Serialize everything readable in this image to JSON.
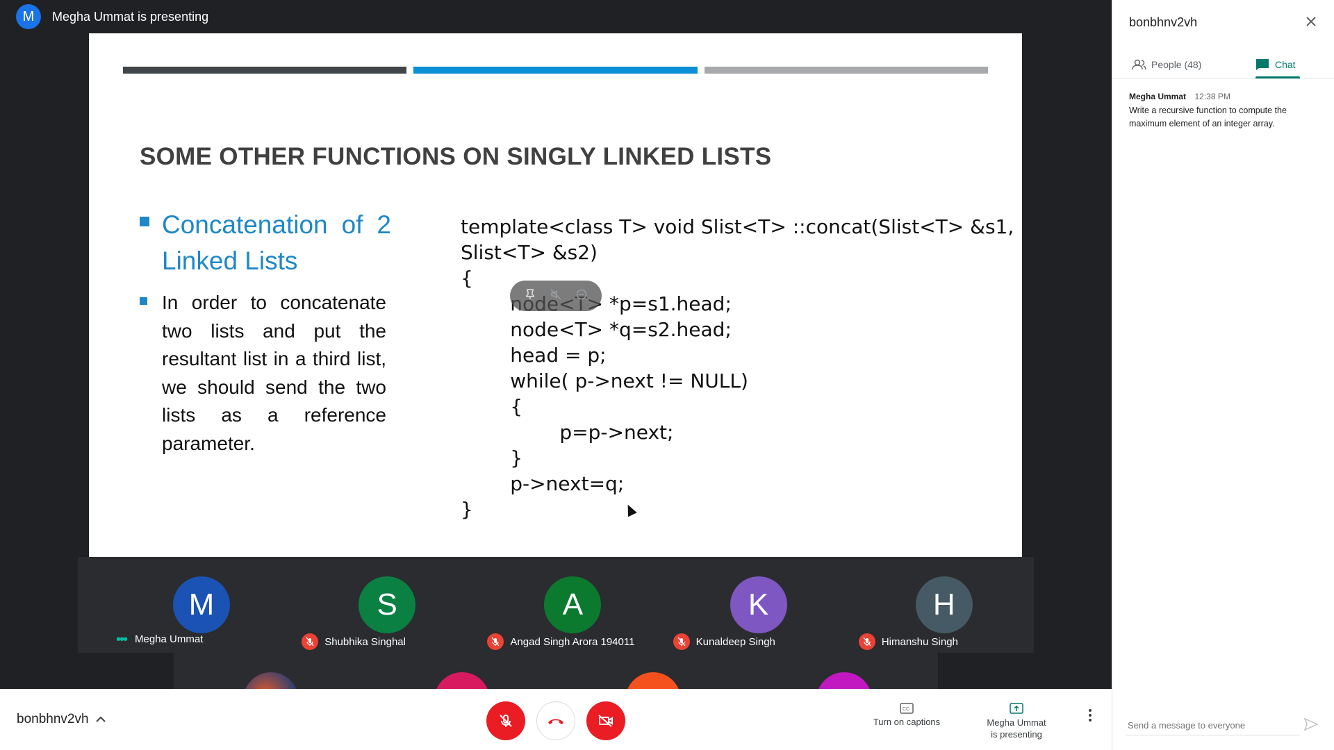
{
  "presenter_banner": {
    "avatar_letter": "M",
    "text": "Megha Ummat is presenting"
  },
  "slide": {
    "bar_colors": [
      "#404549",
      "#0b8fd6",
      "#a7a9ac"
    ],
    "title": "SOME OTHER FUNCTIONS ON SINGLY LINKED LISTS",
    "accent_color": "#1e88c7",
    "bullet1": "Concatenation of 2 Linked Lists",
    "bullet2": "In order to concatenate two lists and put the resultant list in a third list, we should send the two lists as a reference parameter.",
    "code": "template<class T> void Slist<T> ::concat(Slist<T> &s1,\nSlist<T> &s2)\n{\n        node<T> *p=s1.head;\n        node<T> *q=s2.head;\n        head = p;\n        while( p->next != NULL)\n        {\n                p=p->next;\n        }\n        p->next=q;\n}"
  },
  "overlay_icons": [
    "pin-icon",
    "mute-icon",
    "remove-icon"
  ],
  "participants": [
    {
      "letter": "M",
      "name": "Megha Ummat",
      "color": "#1a53b3",
      "speaking": true
    },
    {
      "letter": "S",
      "name": "Shubhika Singhal",
      "color": "#0b8043",
      "speaking": false
    },
    {
      "letter": "A",
      "name": "Angad Singh Arora 194011",
      "color": "#0b7a2f",
      "speaking": false
    },
    {
      "letter": "K",
      "name": "Kunaldeep Singh",
      "color": "#7e57c2",
      "speaking": false
    },
    {
      "letter": "H",
      "name": "Himanshu Singh",
      "color": "#455a64",
      "speaking": false
    }
  ],
  "bottom_bar": {
    "meeting_code": "bonbhnv2vh",
    "captions_label": "Turn on captions",
    "presenting_label_1": "Megha Ummat",
    "presenting_label_2": "is presenting"
  },
  "side_panel": {
    "title": "bonbhnv2vh",
    "tab_people": "People (48)",
    "tab_chat": "Chat",
    "messages": [
      {
        "sender": "Megha Ummat",
        "time": "12:38 PM",
        "text": "Write a recursive function to compute the maximum element of an integer array."
      }
    ],
    "composer_placeholder": "Send a message to everyone"
  }
}
